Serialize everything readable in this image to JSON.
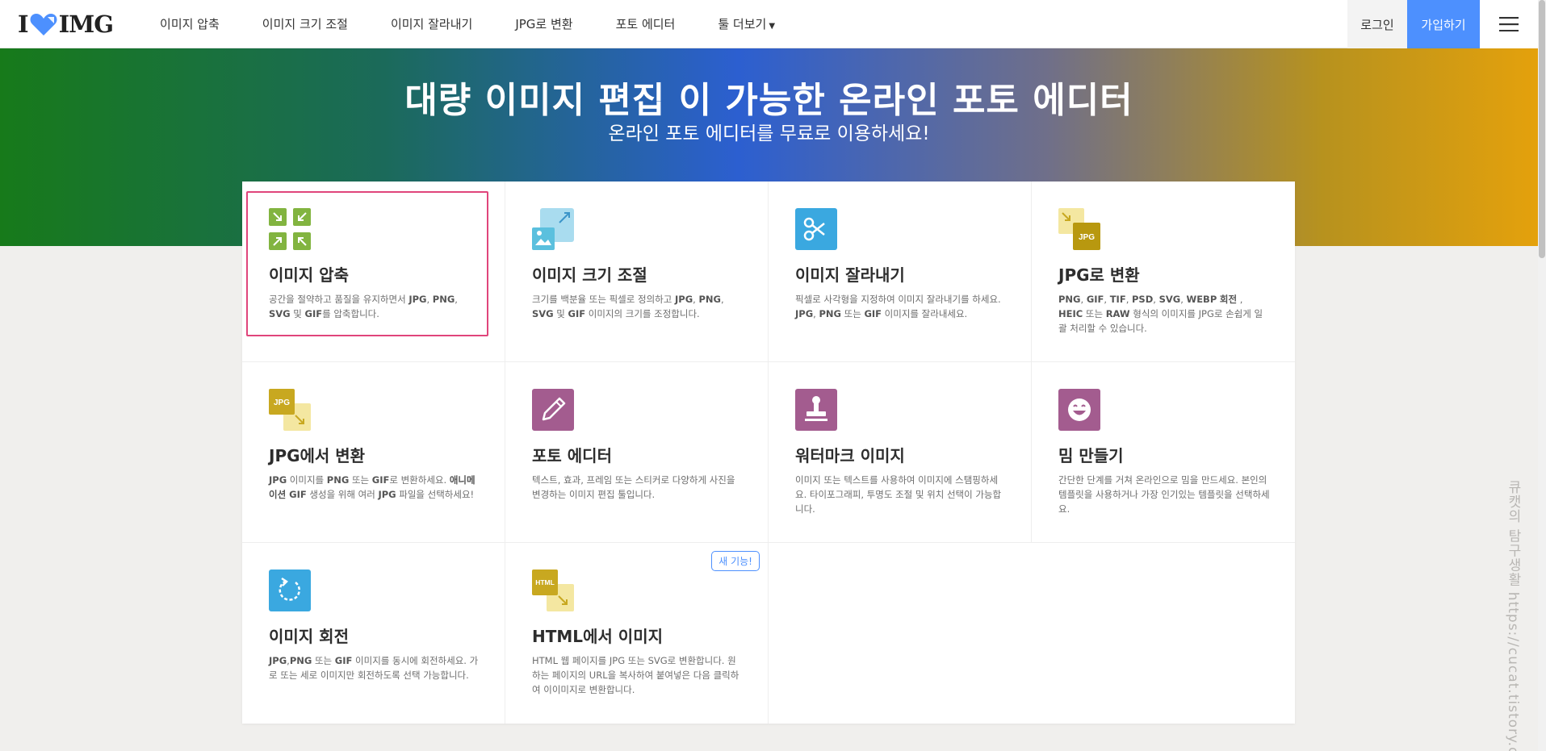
{
  "brand": {
    "left": "I",
    "right": "IMG",
    "heart_color": "#4d90fe"
  },
  "nav": [
    {
      "label": "이미지 압축"
    },
    {
      "label": "이미지 크기 조절"
    },
    {
      "label": "이미지 잘라내기"
    },
    {
      "label": "JPG로 변환"
    },
    {
      "label": "포토 에디터"
    },
    {
      "label": "툴 더보기"
    }
  ],
  "auth": {
    "login": "로그인",
    "signup": "가입하기"
  },
  "hero": {
    "title": "대량 이미지 편집 이 가능한 온라인 포토 에디터",
    "subtitle": "온라인 포토 에디터를 무료로 이용하세요!"
  },
  "tools": [
    {
      "title": "이미지 압축",
      "desc": "공간을 절약하고 품질을 유지하면서 <b>JPG</b>, <b>PNG</b>, <b>SVG</b> 및 <b>GIF</b>를 압축합니다.",
      "icon": "compress-icon",
      "color": "#82b440"
    },
    {
      "title": "이미지 크기 조절",
      "desc": "크기를 백분율 또는 픽셀로 정의하고 <b>JPG</b>, <b>PNG</b>, <b>SVG</b> 및 <b>GIF</b> 이미지의 크기를 조정합니다.",
      "icon": "resize-icon",
      "color": "#5bc0de"
    },
    {
      "title": "이미지 잘라내기",
      "desc": "픽셀로 사각형을 지정하여 이미지 잘라내기를 하세요. <b>JPG</b>, <b>PNG</b> 또는 <b>GIF</b> 이미지를 잘라내세요.",
      "icon": "scissors-icon",
      "color": "#3aa8e0"
    },
    {
      "title": "JPG로 변환",
      "desc": "<b>PNG</b>, <b>GIF</b>, <b>TIF</b>, <b>PSD</b>, <b>SVG</b>, <b>WEBP</b> <b>회전</b> , <b>HEIC</b> 또는 <b>RAW</b> 형식의 이미지를 JPG로 손쉽게 일괄 처리할 수 있습니다.",
      "icon": "to-jpg-icon",
      "color": "#c8a820"
    },
    {
      "title": "JPG에서 변환",
      "desc": "<b>JPG</b> 이미지를 <b>PNG</b> 또는 <b>GIF</b>로 변환하세요. <b>애니메이션 GIF</b> 생성을 위해 여러 <b>JPG</b> 파일을 선택하세요!",
      "icon": "from-jpg-icon",
      "color": "#c8a820"
    },
    {
      "title": "포토 에디터",
      "desc": "텍스트, 효과, 프레임 또는 스티커로 다양하게 사진을 변경하는 이미지 편집 툴입니다.",
      "icon": "pencil-icon",
      "color": "#a35c8f"
    },
    {
      "title": "워터마크 이미지",
      "desc": "이미지 또는 텍스트를 사용하여 이미지에 스탬핑하세요. 타이포그래피, 투명도 조절 및 위치 선택이 가능합니다.",
      "icon": "stamp-icon",
      "color": "#a35c8f"
    },
    {
      "title": "밈 만들기",
      "desc": "간단한 단계를 거쳐 온라인으로 밈을 만드세요. 본인의 템플릿을 사용하거나 가장 인기있는 템플릿을 선택하세요.",
      "icon": "smiley-icon",
      "color": "#a35c8f"
    },
    {
      "title": "이미지 회전",
      "desc": "<b>JPG</b>,<b>PNG</b> 또는 <b>GIF</b> 이미지를 동시에 회전하세요. 가로 또는 세로 이미지만 회전하도록 선택 가능합니다.",
      "icon": "rotate-icon",
      "color": "#3aa8e0"
    },
    {
      "title": "HTML에서 이미지",
      "desc": "HTML 웹 페이지를 JPG 또는 SVG로 변환합니다. 원하는 페이지의 URL을 복사하여 붙여넣은 다음 클릭하여 이이미지로 변환합니다.",
      "icon": "html-icon",
      "color": "#c8a820",
      "badge": "새 기능!"
    }
  ],
  "watermark": "큐캣의 탐구생활 https://cucat.tistory.com/",
  "accent_colors": {
    "highlight": "#e0457b",
    "primary": "#4d90fe"
  }
}
